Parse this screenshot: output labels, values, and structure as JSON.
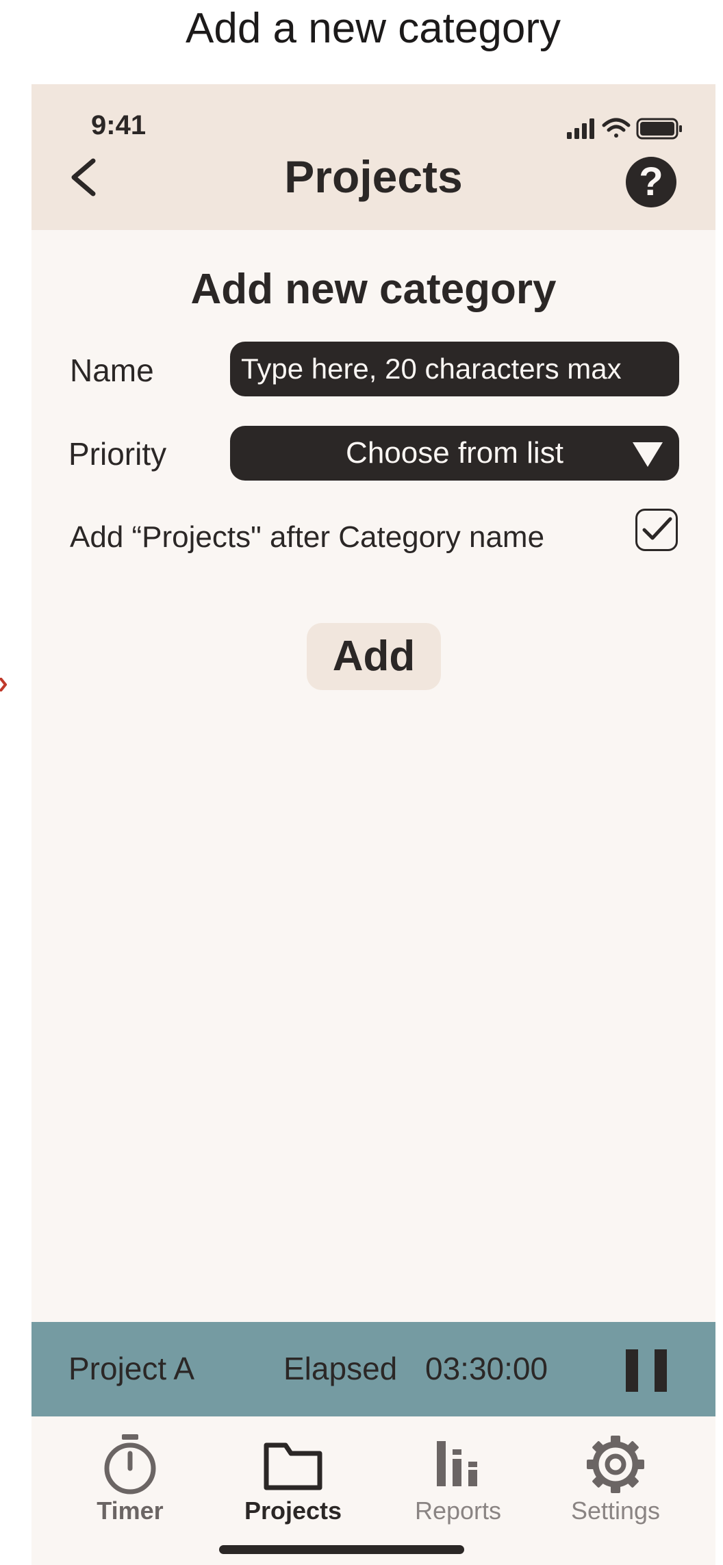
{
  "page_caption": "Add a new category",
  "status_bar": {
    "time": "9:41",
    "icons": [
      "cellular-signal-icon",
      "wifi-icon",
      "battery-icon"
    ]
  },
  "nav": {
    "title": "Projects",
    "back_icon": "chevron-left-icon",
    "help_label": "?"
  },
  "form": {
    "title": "Add new category",
    "name_label": "Name",
    "name_placeholder": "Type here, 20 characters max",
    "name_value": "",
    "priority_label": "Priority",
    "priority_selected": "Choose from list",
    "append_label": "Add “Projects\" after Category name",
    "append_checked": true,
    "add_button": "Add"
  },
  "timer_bar": {
    "project": "Project A",
    "elapsed_label": "Elapsed",
    "elapsed_value": "03:30:00",
    "control_icon": "pause-icon"
  },
  "tab_bar": {
    "tabs": [
      {
        "label": "Timer",
        "icon": "stopwatch-icon",
        "active": false
      },
      {
        "label": "Projects",
        "icon": "folder-icon",
        "active": true
      },
      {
        "label": "Reports",
        "icon": "bar-chart-icon",
        "active": false
      },
      {
        "label": "Settings",
        "icon": "gear-icon",
        "active": false
      }
    ]
  },
  "colors": {
    "header_background": "#f1e6dd",
    "page_background": "#faf6f3",
    "dark": "#2b2726",
    "timer_bar_background": "#759ba2",
    "annotation_red": "#c0392b"
  }
}
